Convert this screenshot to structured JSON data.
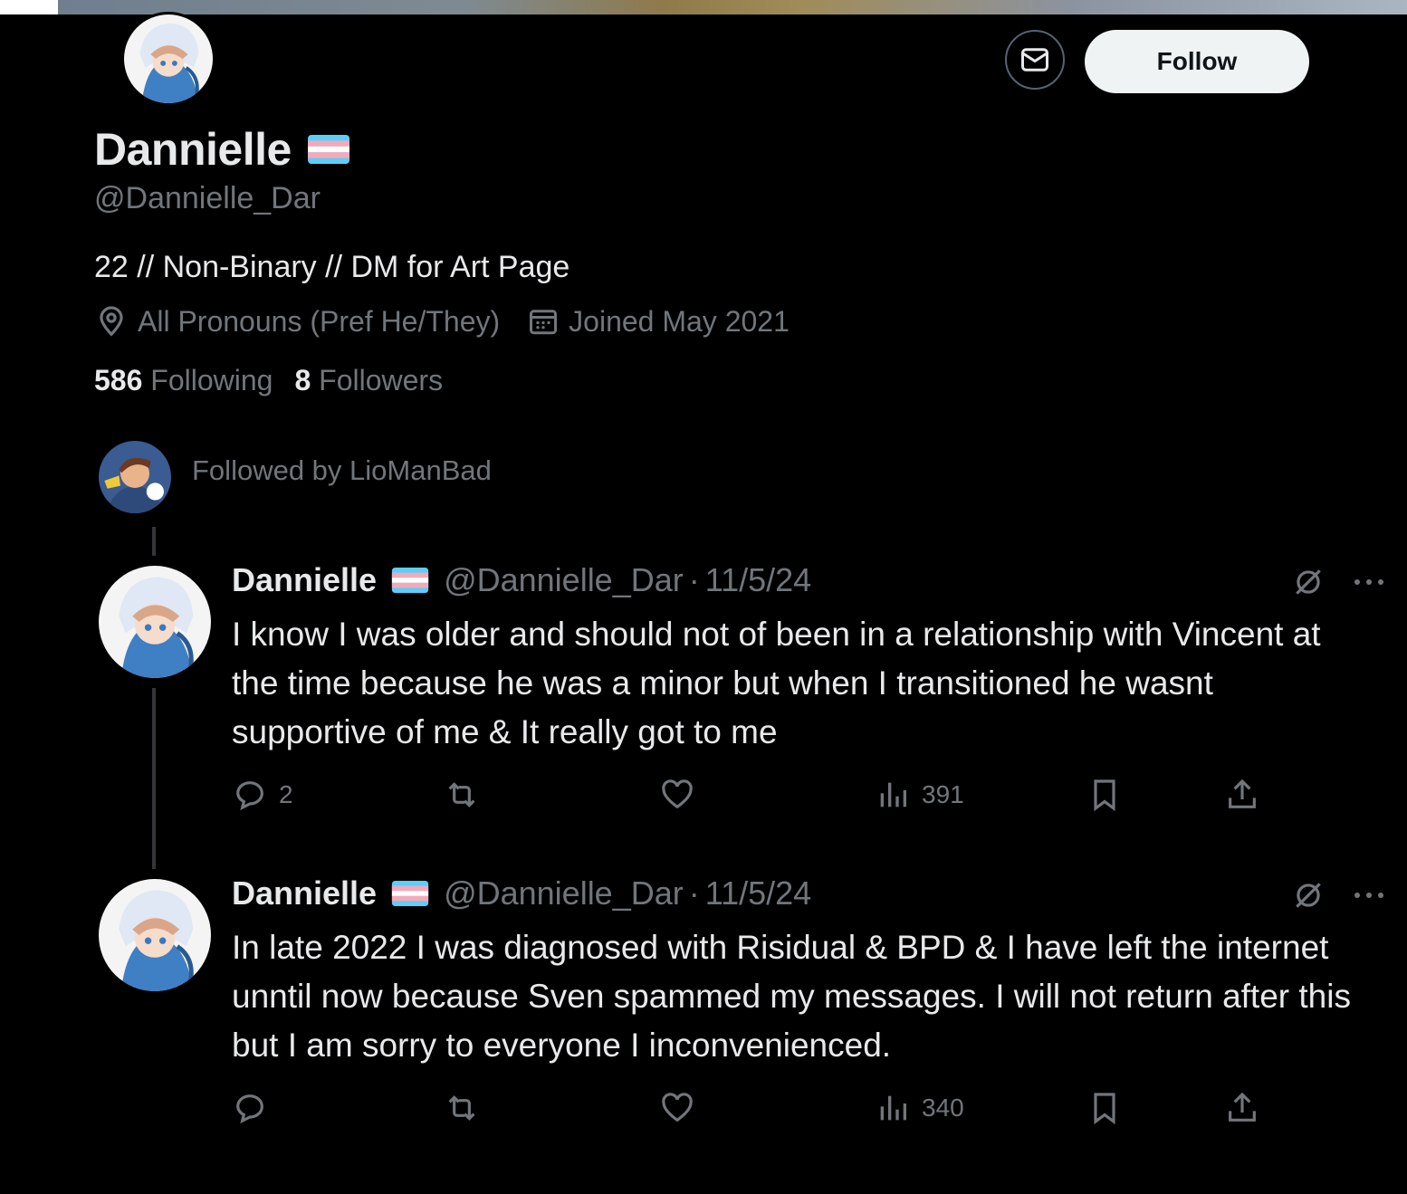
{
  "profile": {
    "name": "Dannielle",
    "handle": "@Dannielle_Dar",
    "bio": "22 // Non-Binary // DM for Art Page",
    "location": "All Pronouns (Pref He/They)",
    "joined": "Joined May 2021",
    "following_count": "586",
    "following_label": "Following",
    "followers_count": "8",
    "followers_label": "Followers",
    "follow_button": "Follow",
    "followed_by": "Followed by LioManBad"
  },
  "colors": {
    "flag_blue": "#5bcefa",
    "flag_pink": "#f5a9b8",
    "flag_white": "#ffffff"
  },
  "tweets": [
    {
      "name": "Dannielle",
      "handle": "@Dannielle_Dar",
      "sep": "·",
      "date": "11/5/24",
      "text": "I know I was older and should not of been in a relationship with Vincent at the time because he was a minor but when I transitioned he wasnt supportive of me & It really got to me",
      "replies": "2",
      "retweets": "",
      "likes": "",
      "views": "391"
    },
    {
      "name": "Dannielle",
      "handle": "@Dannielle_Dar",
      "sep": "·",
      "date": "11/5/24",
      "text": "In late 2022 I was diagnosed with Risidual & BPD & I have left the internet unntil now because Sven spammed my messages. I will not return after this but I am sorry to everyone I inconvenienced.",
      "replies": "",
      "retweets": "",
      "likes": "",
      "views": "340"
    }
  ]
}
